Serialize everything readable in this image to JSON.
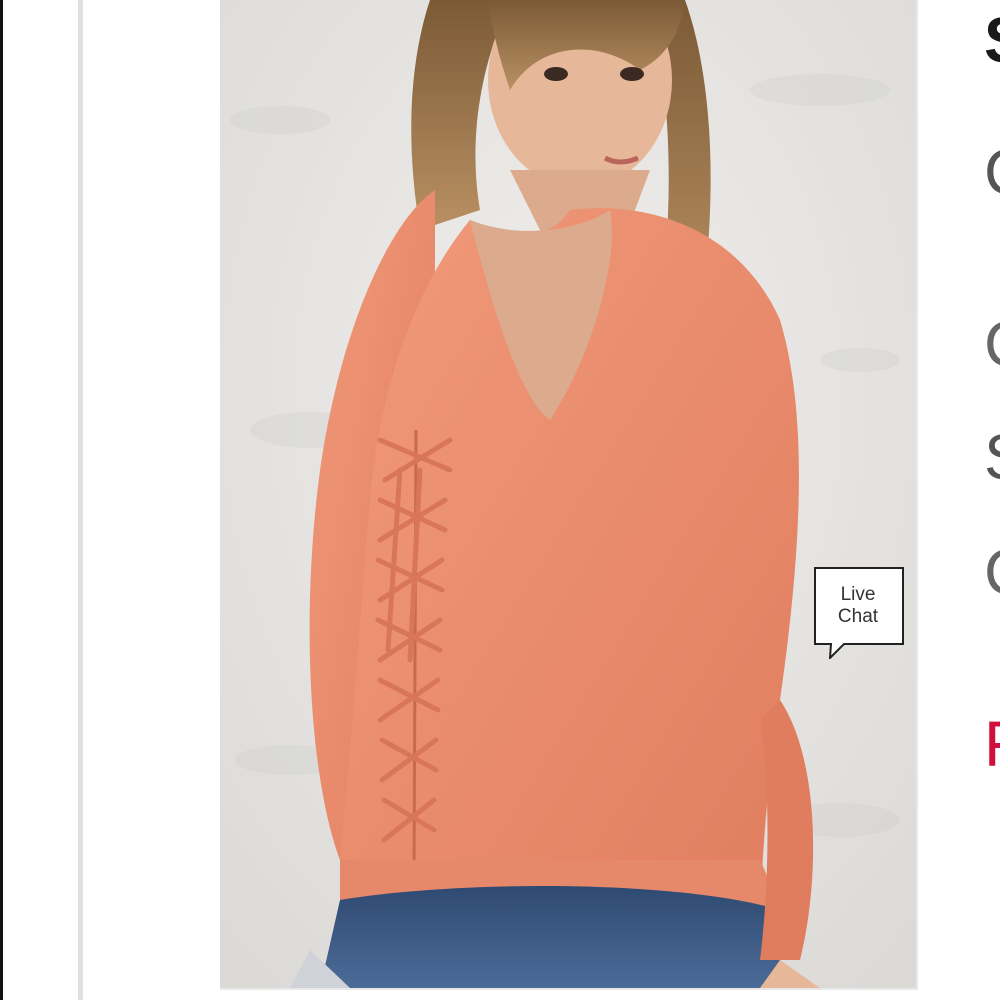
{
  "live_chat": {
    "label": "Live\nChat",
    "border_color": "#222222"
  },
  "product": {
    "image_subject": "model wearing coral lace-up back top with denim shorts",
    "top_color": "#ec8a6a",
    "background_color": "#e9e8e6"
  },
  "side_panel": {
    "title_fragment": "S",
    "line2_fragment": "C",
    "line3_fragment": "C",
    "line4_fragment": "S",
    "line5_fragment": "C",
    "price_fragment": "F",
    "price_color": "#d0103a"
  }
}
